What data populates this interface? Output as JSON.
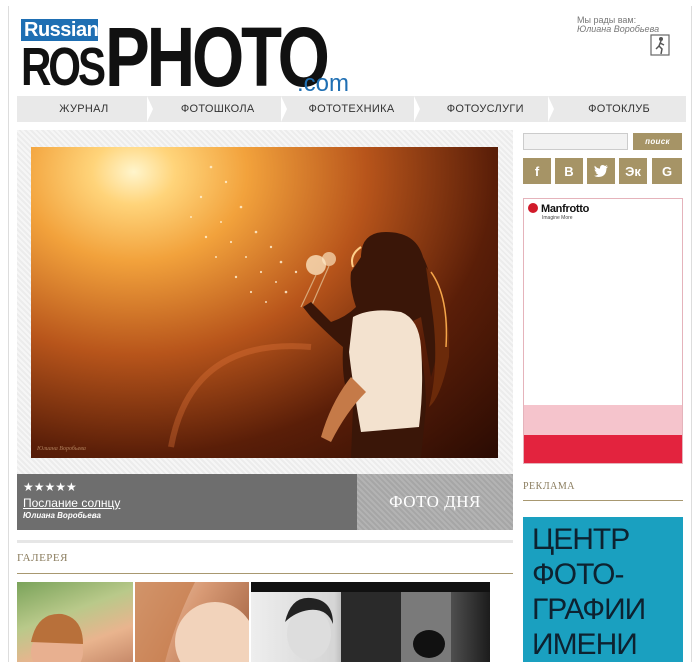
{
  "header": {
    "logo": {
      "badge": "Russian",
      "ros": "ROS",
      "photo": "PHOTO",
      "domain": ".com"
    },
    "welcome_text": "Мы рады вам:",
    "user_name": "Юлиана Воробьева"
  },
  "nav": {
    "items": [
      {
        "label": "ЖУРНАЛ"
      },
      {
        "label": "ФОТОШКОЛА"
      },
      {
        "label": "ФОТОТЕХНИКА"
      },
      {
        "label": "ФОТОУСЛУГИ"
      },
      {
        "label": "ФОТОКЛУБ"
      }
    ]
  },
  "photo_of_day": {
    "stars": "★★★★★",
    "rating": 5,
    "title": "Послание солнцу",
    "author": "Юлиана Воробьева",
    "badge": "ФОТО ДНЯ"
  },
  "gallery": {
    "label": "ГАЛЕРЕЯ"
  },
  "search": {
    "placeholder": "",
    "button_label": "поиск"
  },
  "social": {
    "items": [
      {
        "icon": "facebook-icon",
        "glyph": "f"
      },
      {
        "icon": "vkontakte-icon",
        "glyph": "В"
      },
      {
        "icon": "twitter-icon",
        "glyph": "t"
      },
      {
        "icon": "odnoklassniki-icon",
        "glyph": "Эк"
      },
      {
        "icon": "google-icon",
        "glyph": "G"
      }
    ]
  },
  "ads": {
    "manfrotto": {
      "brand": "Manfrotto",
      "tagline": "Imagine More"
    },
    "label": "РЕКЛАМА",
    "center": {
      "lines": [
        "ЦЕНТР",
        "ФОТО-",
        "ГРАФИИ",
        "ИМЕНИ"
      ]
    }
  },
  "colors": {
    "accent": "#a69466",
    "logo_blue": "#1f6fb3",
    "nav_bg": "#e9e9e9",
    "caption_bg": "#6e6e6e",
    "ad_blue": "#1aa0c0",
    "ad_red": "#e3233e"
  }
}
